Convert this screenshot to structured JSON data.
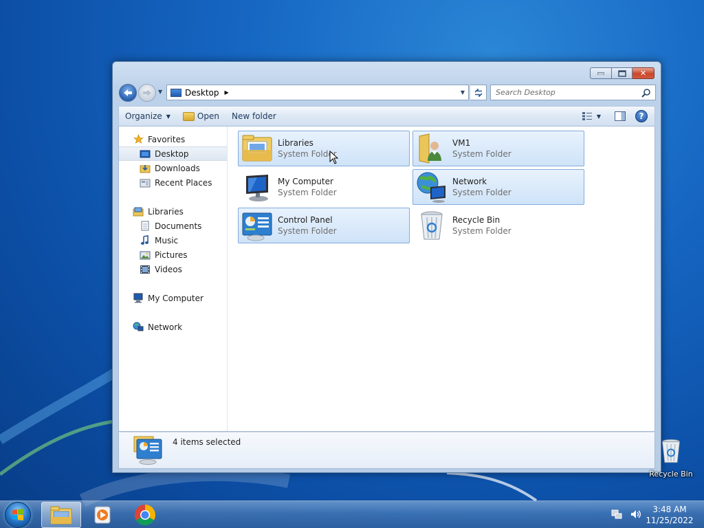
{
  "window": {
    "caption_buttons": [
      "minimize",
      "maximize",
      "close"
    ],
    "close_glyph": "✕"
  },
  "address": {
    "location": "Desktop",
    "search_placeholder": "Search Desktop"
  },
  "commands": {
    "organize": "Organize",
    "open": "Open",
    "new_folder": "New folder"
  },
  "nav": {
    "favorites": "Favorites",
    "desktop": "Desktop",
    "downloads": "Downloads",
    "recent_places": "Recent Places",
    "libraries": "Libraries",
    "documents": "Documents",
    "music": "Music",
    "pictures": "Pictures",
    "videos": "Videos",
    "my_computer": "My Computer",
    "network": "Network"
  },
  "items": [
    {
      "name": "Libraries",
      "type": "System Folder",
      "icon": "libraries-icon",
      "selected": true
    },
    {
      "name": "VM1",
      "type": "System Folder",
      "icon": "user-folder-icon",
      "selected": true
    },
    {
      "name": "My Computer",
      "type": "System Folder",
      "icon": "computer-icon",
      "selected": false
    },
    {
      "name": "Network",
      "type": "System Folder",
      "icon": "network-icon",
      "selected": true
    },
    {
      "name": "Control Panel",
      "type": "System Folder",
      "icon": "control-panel-icon",
      "selected": true
    },
    {
      "name": "Recycle Bin",
      "type": "System Folder",
      "icon": "recycle-bin-icon",
      "selected": false
    }
  ],
  "details": {
    "status": "4 items selected"
  },
  "desktop": {
    "recycle_bin_label": "Recycle Bin"
  },
  "taskbar": {
    "time": "3:48 AM",
    "date": "11/25/2022"
  },
  "colors": {
    "selection_fill": "#cfe3f8",
    "selection_border": "#84acdd",
    "desktop_blue": "#1667c3"
  }
}
